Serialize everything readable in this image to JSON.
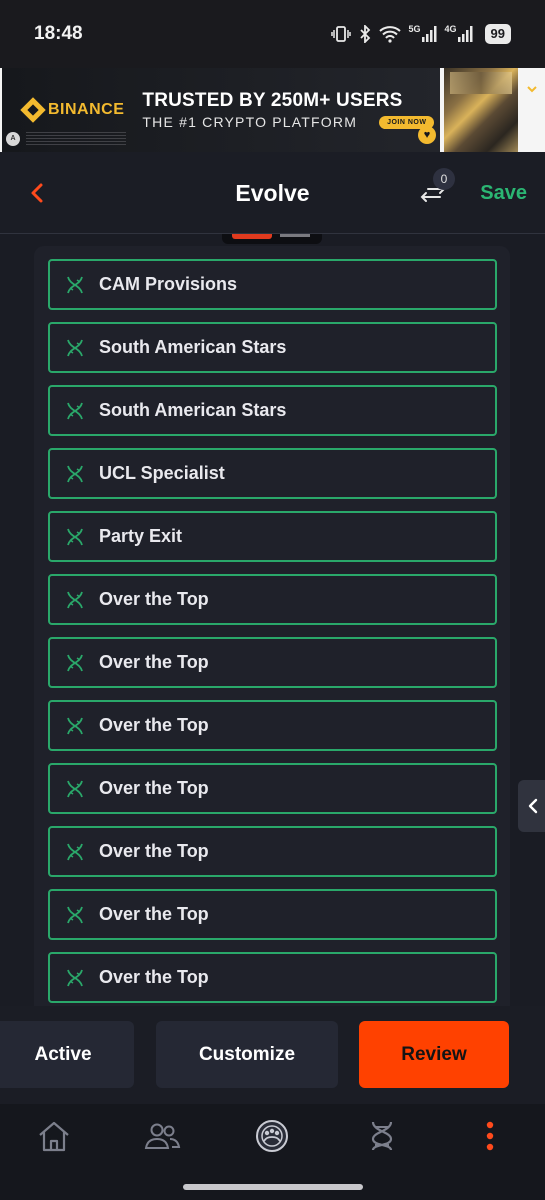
{
  "status_bar": {
    "time": "18:48",
    "network_5g": "5G",
    "network_4g": "4G",
    "battery": "99"
  },
  "ad": {
    "brand": "BINANCE",
    "headline": "TRUSTED BY 250M+ USERS",
    "subline": "THE #1 CRYPTO PLATFORM",
    "cta": "JOIN NOW"
  },
  "header": {
    "title": "Evolve",
    "compare_count": "0",
    "save_label": "Save"
  },
  "evolutions": [
    {
      "label": "CAM Provisions"
    },
    {
      "label": "South American Stars"
    },
    {
      "label": "South American Stars"
    },
    {
      "label": "UCL Specialist"
    },
    {
      "label": "Party Exit"
    },
    {
      "label": "Over the Top"
    },
    {
      "label": "Over the Top"
    },
    {
      "label": "Over the Top"
    },
    {
      "label": "Over the Top"
    },
    {
      "label": "Over the Top"
    },
    {
      "label": "Over the Top"
    },
    {
      "label": "Over the Top"
    }
  ],
  "actions": {
    "active_label": "Active",
    "customize_label": "Customize",
    "review_label": "Review"
  },
  "colors": {
    "accent_green": "#2aa86a",
    "save_green": "#2bb673",
    "review_orange": "#ff4100",
    "back_red": "#ff4a1c"
  },
  "nav": {
    "items": [
      "home-icon",
      "people-icon",
      "club-icon",
      "evolutions-icon",
      "more-icon"
    ]
  }
}
